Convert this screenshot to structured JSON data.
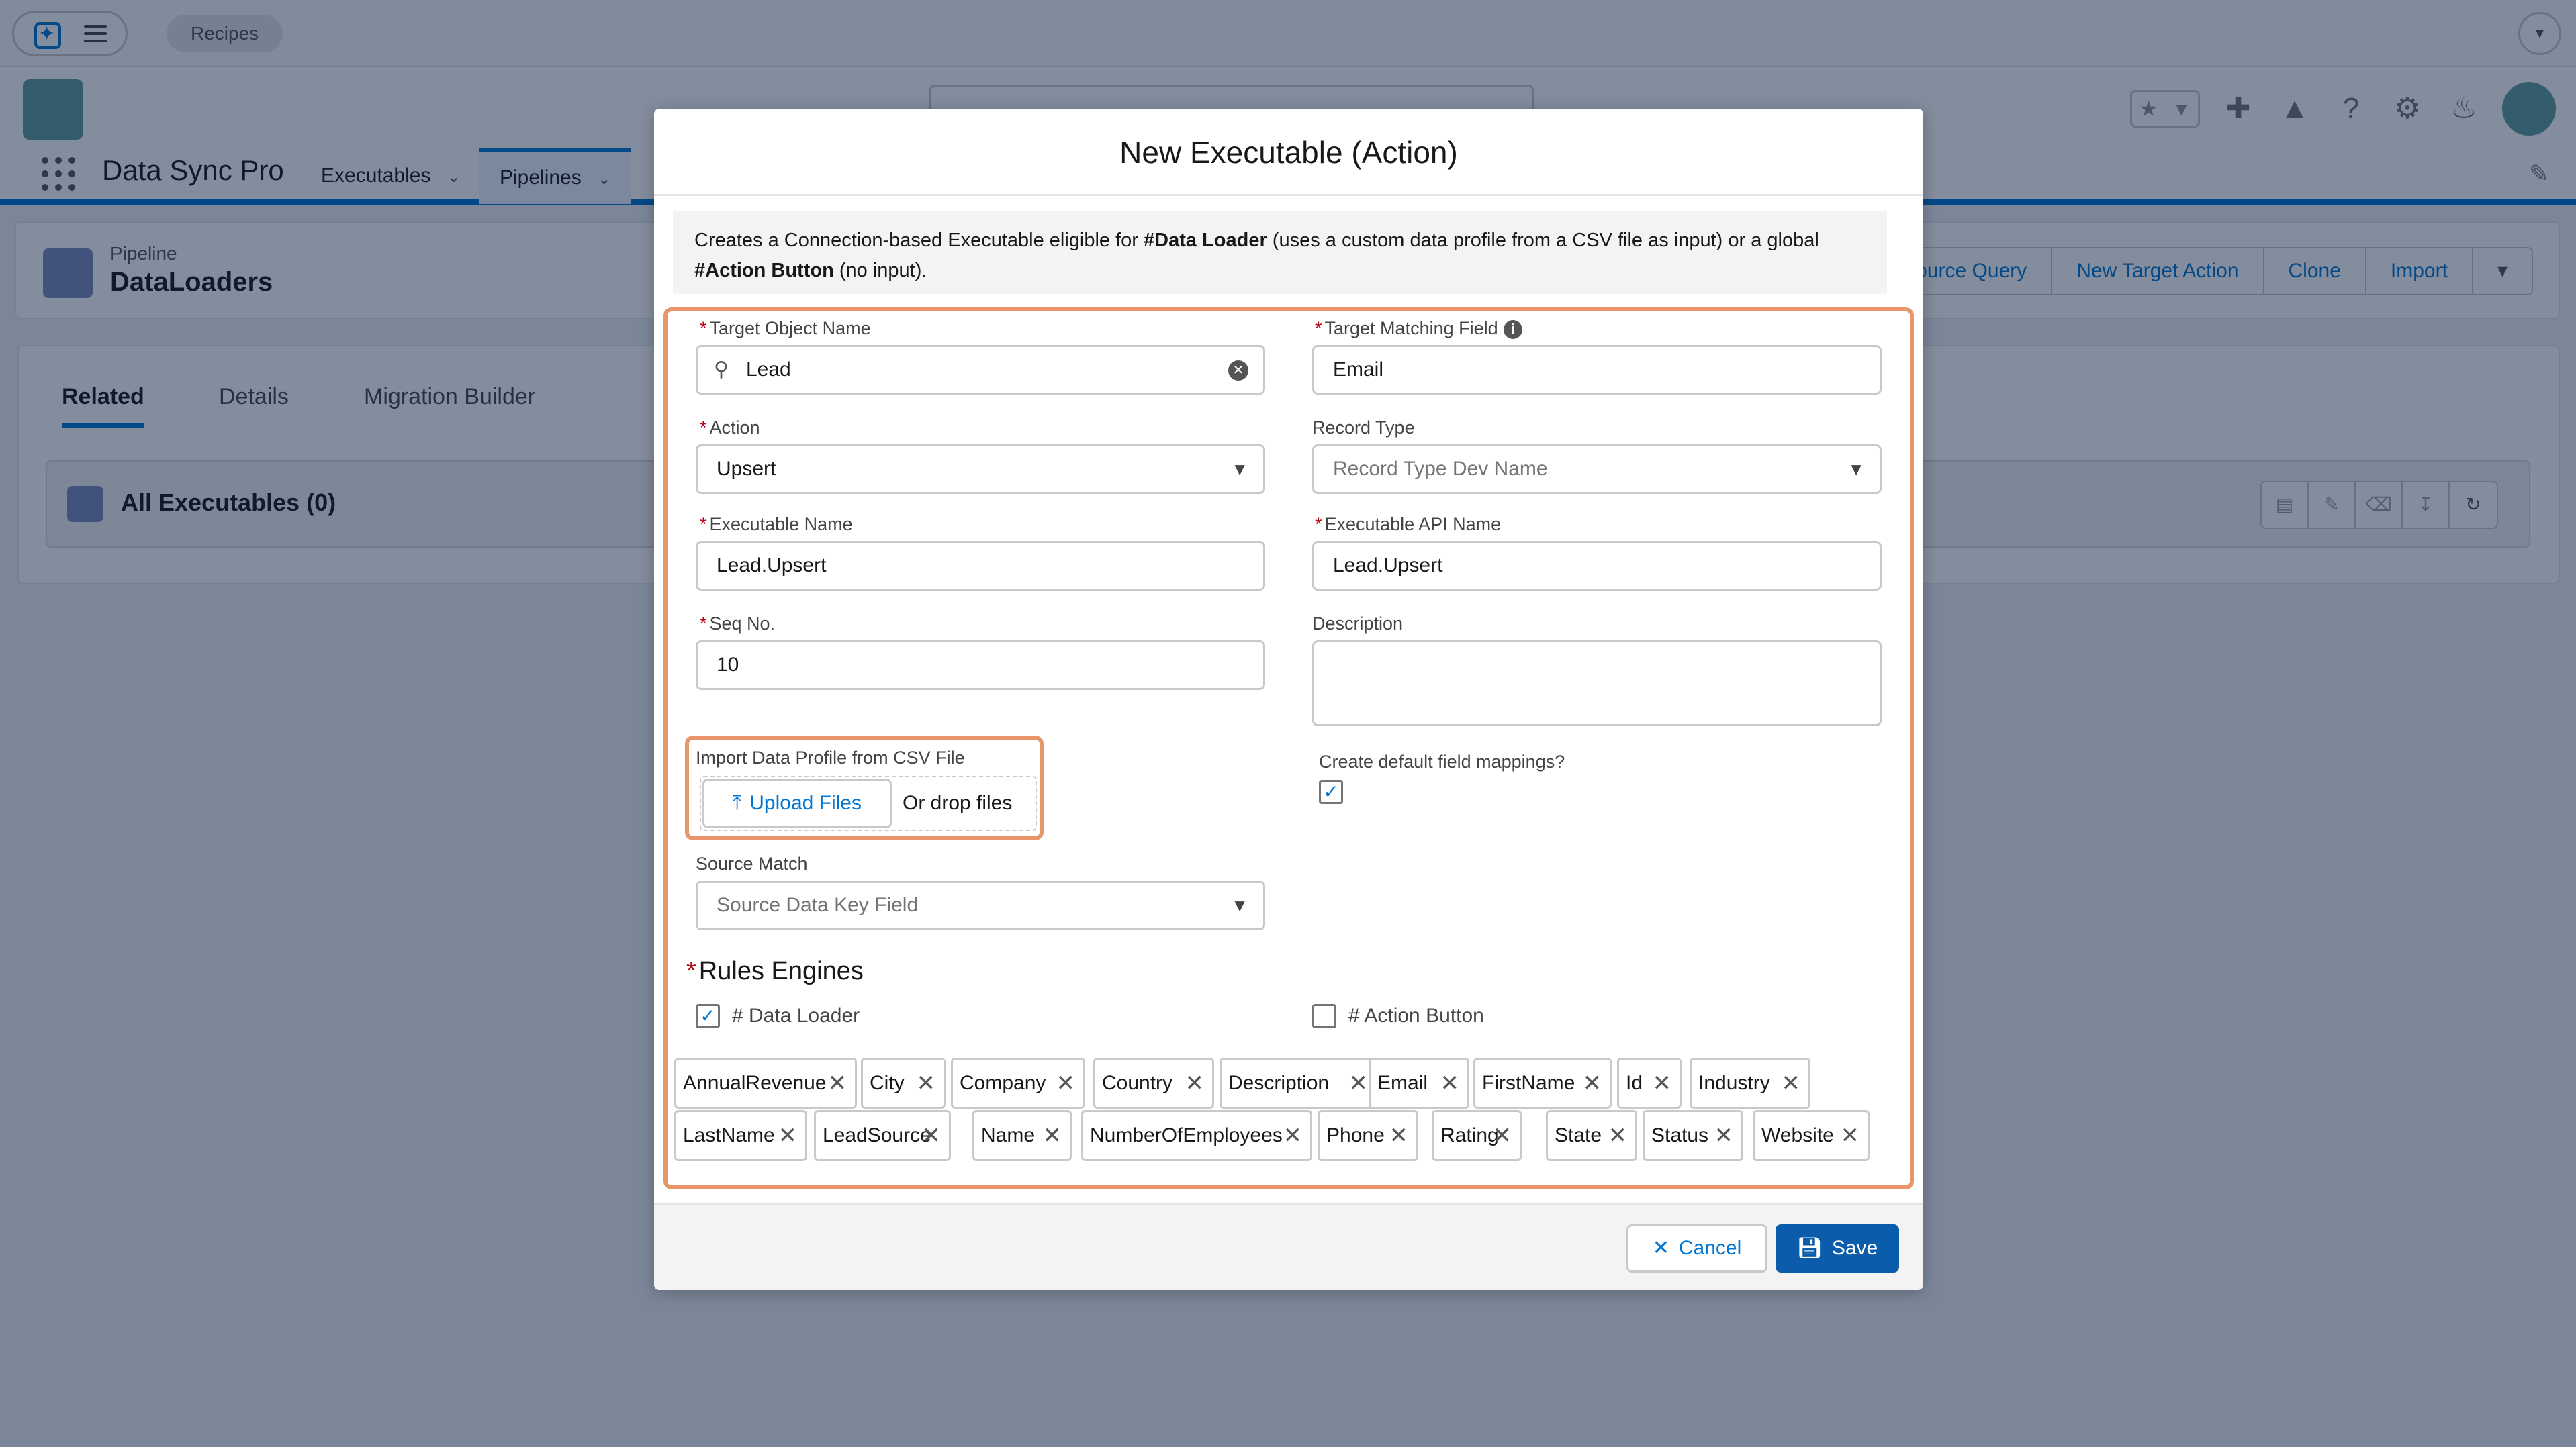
{
  "topbar": {
    "recipes_label": "Recipes"
  },
  "nav": {
    "app_name": "Data Sync Pro",
    "items": [
      {
        "label": "Executables"
      },
      {
        "label": "Pipelines"
      }
    ]
  },
  "page_header": {
    "object_label": "Pipeline",
    "record_name": "DataLoaders",
    "buttons": [
      "Source Query",
      "New Target Action",
      "Clone",
      "Import"
    ]
  },
  "related": {
    "tabs": [
      "Related",
      "Details",
      "Migration Builder"
    ],
    "card_title": "All Executables (0)"
  },
  "modal": {
    "title": "New Executable (Action)",
    "info": {
      "part1": "Creates a Connection-based Executable eligible for ",
      "bold1": "#Data Loader",
      "part2": " (uses a custom data profile from a CSV file as input) or a global ",
      "bold2": "#Action Button",
      "part3": " (no input)."
    },
    "fields": {
      "target_object": {
        "label": "Target Object Name",
        "value": "Lead"
      },
      "target_matching": {
        "label": "Target Matching Field",
        "value": "Email"
      },
      "action": {
        "label": "Action",
        "value": "Upsert"
      },
      "record_type": {
        "label": "Record Type",
        "placeholder": "Record Type Dev Name"
      },
      "executable_name": {
        "label": "Executable Name",
        "value": "Lead.Upsert"
      },
      "executable_api_name": {
        "label": "Executable API Name",
        "value": "Lead.Upsert"
      },
      "seq_no": {
        "label": "Seq No.",
        "value": "10"
      },
      "description": {
        "label": "Description",
        "value": ""
      },
      "import_profile": {
        "label": "Import Data Profile from CSV File",
        "upload_label": "Upload Files",
        "drop_label": "Or drop files"
      },
      "default_mappings": {
        "label": "Create default field mappings?",
        "checked": true
      },
      "source_match": {
        "label": "Source Match",
        "placeholder": "Source Data Key Field"
      }
    },
    "rules_engines": {
      "title": "Rules Engines",
      "data_loader": {
        "label": "# Data Loader",
        "checked": true
      },
      "action_button": {
        "label": "# Action Button",
        "checked": false
      }
    },
    "field_pills": [
      "AnnualRevenue",
      "City",
      "Company",
      "Country",
      "Description",
      "Email",
      "FirstName",
      "Id",
      "Industry",
      "LastName",
      "LeadSource",
      "Name",
      "NumberOfEmployees",
      "Phone",
      "Rating",
      "State",
      "Status",
      "Website"
    ],
    "footer": {
      "cancel_label": "Cancel",
      "save_label": "Save"
    }
  },
  "colors": {
    "brand": "#0176d3",
    "save": "#0b5cab",
    "highlight": "#e8966a",
    "required": "#ba0517"
  }
}
